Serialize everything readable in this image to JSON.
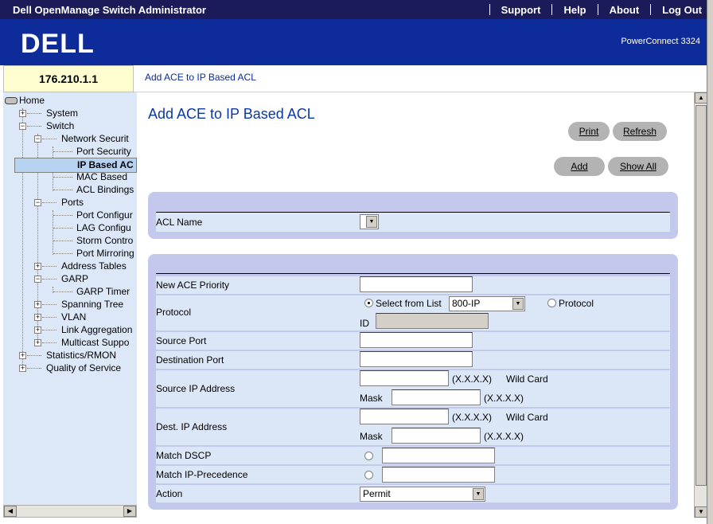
{
  "topbar": {
    "title": "Dell OpenManage Switch Administrator",
    "support": "Support",
    "help": "Help",
    "about": "About",
    "logout": "Log Out"
  },
  "banner": {
    "brand": "DELL",
    "model": "PowerConnect 3324"
  },
  "ip_address": "176.210.1.1",
  "breadcrumb": "Add ACE to IP Based ACL",
  "tree": {
    "home": "Home",
    "system": "System",
    "switch": "Switch",
    "network_security": "Network Securit",
    "port_security": "Port Security",
    "ip_based_acl": "IP Based AC",
    "mac_based": "MAC Based",
    "acl_bindings": "ACL Bindings",
    "ports": "Ports",
    "port_config": "Port Configur",
    "lag_config": "LAG Configu",
    "storm_control": "Storm Contro",
    "port_mirroring": "Port Mirroring",
    "address_tables": "Address Tables",
    "garp": "GARP",
    "garp_timer": "GARP Timer",
    "spanning_tree": "Spanning Tree",
    "vlan": "VLAN",
    "link_aggregation": "Link Aggregation",
    "multicast": "Multicast Suppo",
    "statistics": "Statistics/RMON",
    "qos": "Quality of Service"
  },
  "page": {
    "title": "Add ACE to IP Based ACL",
    "buttons": {
      "print": "Print",
      "refresh": "Refresh",
      "add": "Add",
      "show_all": "Show All"
    }
  },
  "form": {
    "acl_name_label": "ACL Name",
    "acl_name_value": "",
    "new_ace_priority_label": "New ACE Priority",
    "new_ace_priority_value": "",
    "protocol_label": "Protocol",
    "select_from_list_label": "Select from List",
    "protocol_select_value": "800-IP",
    "protocol_radio_label": "Protocol",
    "id_label": "ID",
    "id_value": "",
    "source_port_label": "Source Port",
    "source_port_value": "",
    "destination_port_label": "Destination Port",
    "destination_port_value": "",
    "source_ip_label": "Source IP Address",
    "source_ip_value": "",
    "source_ip_format": "(X.X.X.X)",
    "wild_card_label": "Wild Card",
    "mask_label": "Mask",
    "source_mask_value": "",
    "source_mask_format": "(X.X.X.X)",
    "dest_ip_label": "Dest. IP Address",
    "dest_ip_value": "",
    "dest_ip_format": "(X.X.X.X)",
    "dest_wild_card_label": "Wild Card",
    "dest_mask_label": "Mask",
    "dest_mask_value": "",
    "dest_mask_format": "(X.X.X.X)",
    "match_dscp_label": "Match DSCP",
    "match_dscp_value": "",
    "match_ip_prec_label": "Match IP-Precedence",
    "match_ip_prec_value": "",
    "action_label": "Action",
    "action_value": "Permit"
  },
  "colors": {
    "topbar": "#1b1b5a",
    "banner": "#0d2c9a",
    "panel": "#c2c9ec",
    "row": "#dbe6f7",
    "title": "#0a3aa0"
  },
  "icons": {
    "expand": "plus-box-icon",
    "collapse": "minus-box-icon",
    "home": "home-drive-icon"
  }
}
